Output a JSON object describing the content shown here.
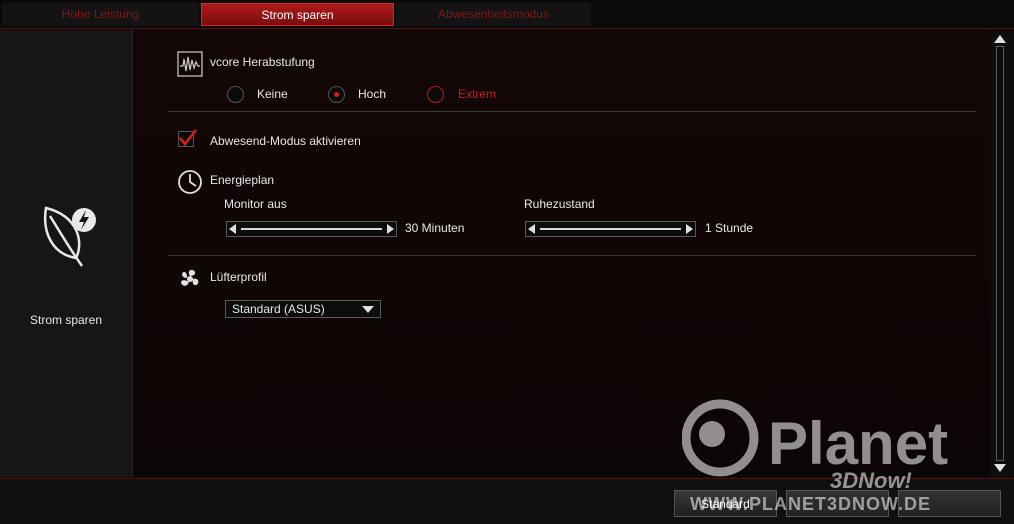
{
  "tabs": [
    {
      "label": "Hohe Leistung",
      "active": false
    },
    {
      "label": "Strom sparen",
      "active": true
    },
    {
      "label": "Abwesenheitsmodus",
      "active": false
    }
  ],
  "sidebar": {
    "label": "Strom sparen",
    "icon": "leaf-bolt-icon"
  },
  "vcore": {
    "title": "vcore Herabstufung",
    "options": [
      {
        "label": "Keine",
        "selected": false
      },
      {
        "label": "Hoch",
        "selected": true
      },
      {
        "label": "Extrem",
        "selected": false
      }
    ]
  },
  "away_mode": {
    "label": "Abwesend-Modus aktivieren",
    "checked": true
  },
  "energy_plan": {
    "title": "Energieplan",
    "monitor": {
      "label": "Monitor aus",
      "value": "30 Minuten"
    },
    "sleep": {
      "label": "Ruhezustand",
      "value": "1 Stunde"
    }
  },
  "fan_profile": {
    "title": "Lüfterprofil",
    "selected": "Standard (ASUS)"
  },
  "footer": {
    "standard_label": "Standard"
  },
  "watermark": {
    "brand": "Planet",
    "sub": "3DNow!",
    "url": "WWW.PLANET3DNOW.DE"
  },
  "colors": {
    "accent": "#b01a1a",
    "highlight": "#d81c1c",
    "extreme": "#c21b1b"
  }
}
